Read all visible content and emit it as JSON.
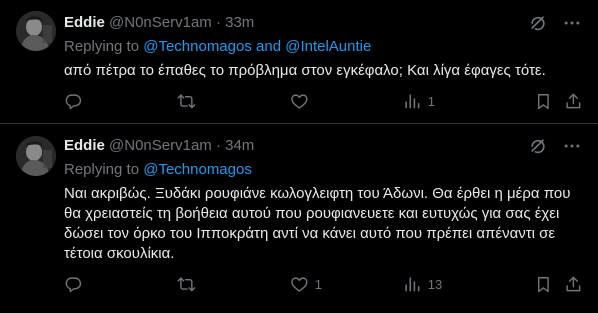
{
  "tweets": [
    {
      "name": "Eddie",
      "handle": "@N0nServ1am",
      "dot": "·",
      "time": "33m",
      "replying_prefix": "Replying to ",
      "mention_1": "@Technomagos",
      "replying_and": " and ",
      "mention_2": "@IntelAuntie",
      "text": "από πέτρα το έπαθες το πρόβλημα στον εγκέφαλο; Και λίγα έφαγες τότε.",
      "counts": {
        "reply": "",
        "retweet": "",
        "like": "",
        "views": "1"
      }
    },
    {
      "name": "Eddie",
      "handle": "@N0nServ1am",
      "dot": "·",
      "time": "34m",
      "replying_prefix": "Replying to ",
      "mention_1": "@Technomagos",
      "text_lines": [
        "Ναι ακριβώς. Ξυδάκι ρουφιάνε κωλογλειφτη του Άδωνι. Θα έρθει η μέρα που",
        "θα χρειαστείς τη βοήθεια αυτού που ρουφιανευετε και ευτυχώς για σας έχει",
        "δώσει τον όρκο του Ιπποκράτη αντί να κάνει αυτό που πρέπει απέναντι σε",
        "τέτοια σκουλίκια."
      ],
      "counts": {
        "reply": "",
        "retweet": "",
        "like": "1",
        "views": "13"
      }
    }
  ],
  "icons": {
    "grok": "grok-icon",
    "more": "more-icon",
    "reply": "reply-icon",
    "retweet": "retweet-icon",
    "like": "like-icon",
    "views": "views-icon",
    "bookmark": "bookmark-icon",
    "share": "share-icon"
  },
  "colors": {
    "background": "#000000",
    "text": "#e7e9ea",
    "secondary": "#71767b",
    "link": "#1d9bf0",
    "divider": "#2f3336"
  }
}
